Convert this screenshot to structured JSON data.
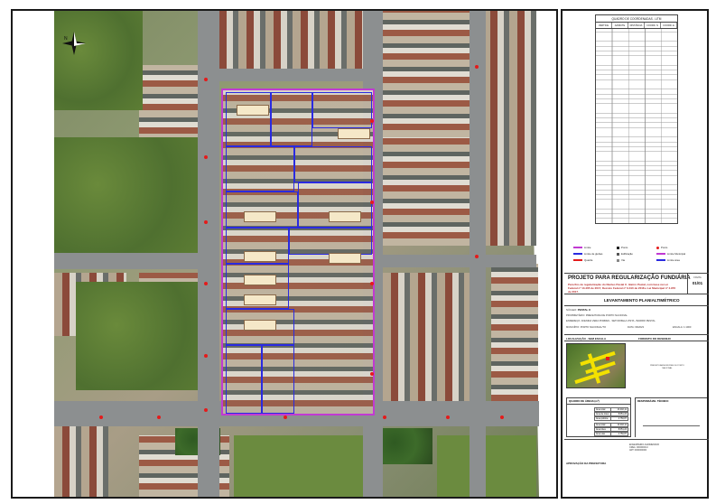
{
  "map": {
    "north_arrow": "north-arrow-icon",
    "north_letter": "N",
    "lot_labels": 16
  },
  "coordinates_table": {
    "title": "QUADRO DE COORDENADAS - UTM",
    "columns": [
      "VÉRTICE",
      "AZIMUTE",
      "DISTÂNCIA",
      "COORD. N",
      "COORD. E"
    ],
    "row_count": 48
  },
  "legend": {
    "items": [
      {
        "label": "Limite",
        "color": "#c13ad2"
      },
      {
        "label": "Limite de glebas",
        "color": "#2a2ae0"
      },
      {
        "label": "Quadra",
        "color": "#e41b1b"
      },
      {
        "label": "Ponto",
        "color": "#222222"
      },
      {
        "label": "Edificação",
        "color": "#555555"
      },
      {
        "label": "Via",
        "color": "#888888"
      },
      {
        "label": "Ponto",
        "color": "#e41b1b"
      },
      {
        "label": "Limite Municipal",
        "color": "#c13ad2"
      },
      {
        "label": "Limite área",
        "color": "#2a2ae0"
      }
    ]
  },
  "title_block": {
    "main_title": "PROJETO PARA REGULARIZAÇÃO FUNDIÁRIA",
    "subtitle": "Para fins de regularização do Núcleo Pastal II - Bairro Pastal, com base na Lei Federal nº 13.465 de 2017, Decreto Federal nº 9.310 de 2018 e Lei Municipal nº 4.976 de 2017.",
    "sheet_label": "FOLHA",
    "sheet_number": "01/01",
    "survey_title": "LEVANTAMENTO PLANIALTIMÉTRICO",
    "nucleus_label": "NÚCLEO",
    "nucleus_value": "PESTAL II",
    "owner_label": "PROPRIETÁRIO",
    "owner_value": "PREFEITURA DE PORTO NACIONAL",
    "address_label": "ENDEREÇO",
    "address_value": "AVENIDA VERA PORRES - SETOR BELA VISTA - BAIRRO PESTAL",
    "city_label": "MUNICÍPIO",
    "city_value": "PORTO NACIONAL/TO",
    "date_label": "DATA",
    "date_value": "09/2023",
    "scale_label": "ESCALA",
    "scale_value": "1:1000"
  },
  "location": {
    "heading": "LOCALIZAÇÃO - SEM ESCALA",
    "drawings_heading": "FORMATO DO DESENHO"
  },
  "stamp_text": "PREFEITURA MUNICIPAL DE PORTO NACIONAL",
  "area_table": {
    "heading": "QUADRO DE ÁREAS (m²)",
    "rows": [
      {
        "label": "Área total",
        "value": "13.402,11"
      },
      {
        "label": "Área de lotes",
        "value": "8.651,24"
      },
      {
        "label": "Área pública",
        "value": "4.750,87"
      },
      {
        "label": "Área total",
        "value": "13.402,11"
      },
      {
        "label": "Área lotes",
        "value": "8.651,24"
      },
      {
        "label": "Área vias",
        "value": "4.750,87"
      }
    ]
  },
  "responsible": {
    "heading": "RESPONSÁVEL TÉCNICO",
    "signature_lines": [
      "ENGENHEIRO AGRIMENSOR",
      "CREA: 00000000-0",
      "ART: 0000000000"
    ]
  },
  "footer": {
    "approval_label": "APROVAÇÃO DA PREFEITURA"
  }
}
